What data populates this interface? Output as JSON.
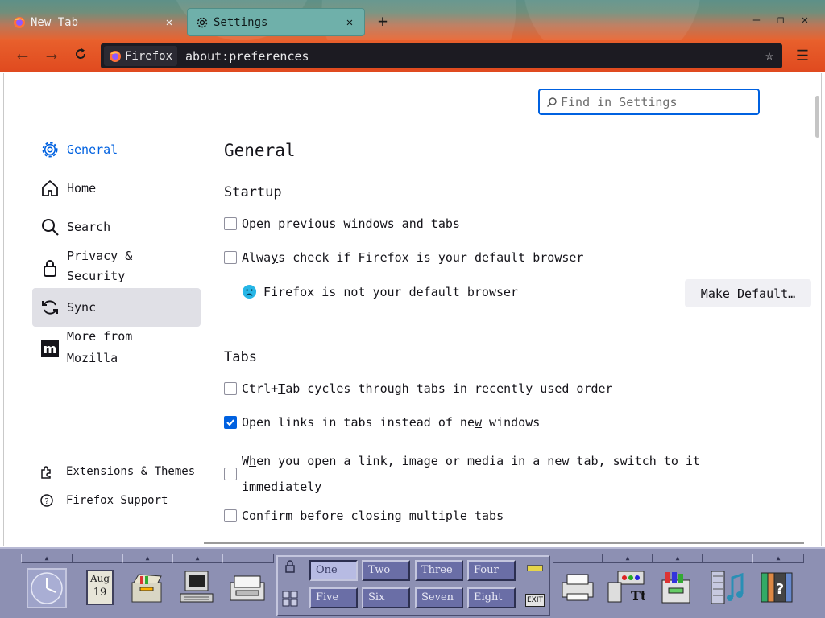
{
  "tabs": [
    {
      "title": "New Tab",
      "active": false
    },
    {
      "title": "Settings",
      "active": true
    }
  ],
  "toolbar": {
    "identity_label": "Firefox",
    "url": "about:preferences"
  },
  "search": {
    "placeholder": "Find in Settings"
  },
  "sidebar": {
    "items": [
      {
        "label": "General",
        "icon": "gear-icon",
        "selected": true
      },
      {
        "label": "Home",
        "icon": "home-icon"
      },
      {
        "label": "Search",
        "icon": "search-icon"
      },
      {
        "label_line1": "Privacy &",
        "label_line2": "Security",
        "icon": "lock-icon"
      },
      {
        "label": "Sync",
        "icon": "sync-icon"
      },
      {
        "label_line1": "More from",
        "label_line2": "Mozilla",
        "icon": "mozilla-icon"
      }
    ],
    "footer": [
      {
        "label": "Extensions & Themes",
        "icon": "puzzle-icon"
      },
      {
        "label": "Firefox Support",
        "icon": "help-icon"
      }
    ]
  },
  "main": {
    "title": "General",
    "startup": {
      "heading": "Startup",
      "open_previous": {
        "pre": "Open previou",
        "ul": "s",
        "post": " windows and tabs",
        "checked": false
      },
      "always_check": {
        "pre": "Alwa",
        "ul": "y",
        "post": "s check if Firefox is your default browser",
        "checked": false
      },
      "not_default": "Firefox is not your default browser",
      "make_default": {
        "pre": "Make ",
        "ul": "D",
        "post": "efault…"
      }
    },
    "tabs_section": {
      "heading": "Tabs",
      "ctrl_tab": {
        "pre": "Ctrl+",
        "ul": "T",
        "post": "ab cycles through tabs in recently used order",
        "checked": false
      },
      "open_links": {
        "pre": "Open links in tabs instead of ne",
        "ul": "w",
        "post": " windows",
        "checked": true
      },
      "switch_line1": {
        "pre": "W",
        "ul": "h",
        "post": "en you open a link, image or media in a new tab, switch to it"
      },
      "switch_line2": "immediately",
      "confirm_close": {
        "pre": "Confir",
        "ul": "m",
        "post": " before closing multiple tabs",
        "checked": false
      }
    }
  },
  "panel": {
    "date_month": "Aug",
    "date_day": "19",
    "workspaces": [
      "One",
      "Two",
      "Three",
      "Four",
      "Five",
      "Six",
      "Seven",
      "Eight"
    ],
    "active_workspace": "One",
    "exit_label": "EXIT"
  },
  "colors": {
    "accent": "#0061e0",
    "toolbar": "#e04a1f",
    "panel": "#8d90b3"
  }
}
